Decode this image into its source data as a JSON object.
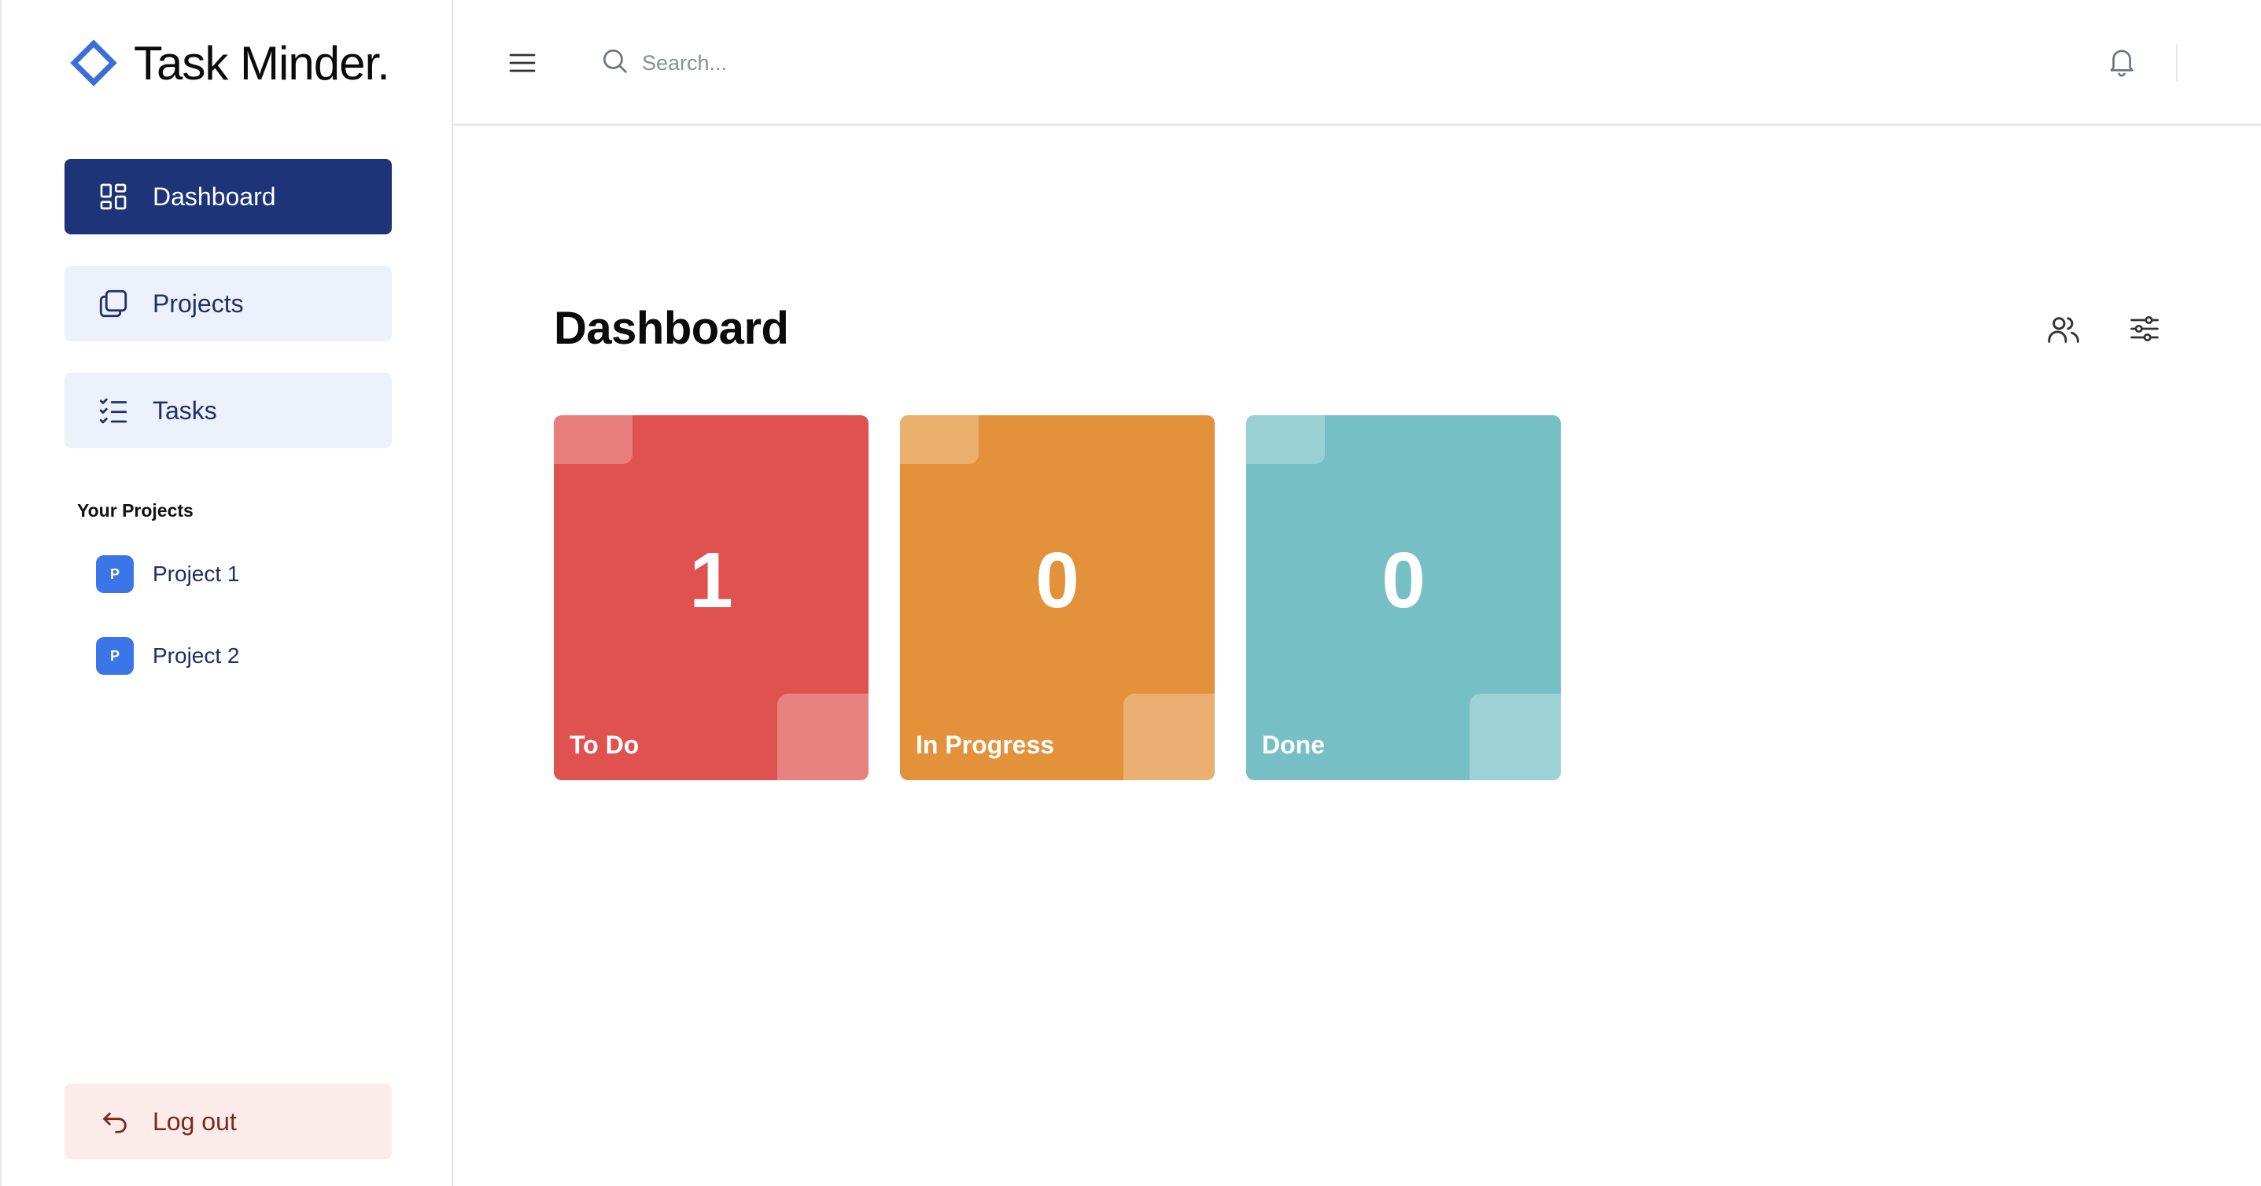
{
  "app": {
    "logo_text": "Task Minder."
  },
  "sidebar": {
    "nav": [
      {
        "label": "Dashboard",
        "icon": "dashboard-icon",
        "active": true
      },
      {
        "label": "Projects",
        "icon": "folders-icon",
        "active": false
      },
      {
        "label": "Tasks",
        "icon": "checklist-icon",
        "active": false
      }
    ],
    "section_title": "Your Projects",
    "projects": [
      {
        "badge": "P",
        "name": "Project 1"
      },
      {
        "badge": "P",
        "name": "Project 2"
      }
    ],
    "logout_label": "Log out"
  },
  "header": {
    "search_placeholder": "Search...",
    "icons": [
      "menu-icon",
      "search-icon",
      "bell-icon"
    ]
  },
  "main": {
    "title": "Dashboard",
    "tools": [
      "team-icon",
      "filter-icon"
    ],
    "cards": [
      {
        "count": "1",
        "label": "To Do",
        "color": "#df524f"
      },
      {
        "count": "0",
        "label": "In Progress",
        "color": "#e3923b"
      },
      {
        "count": "0",
        "label": "Done",
        "color": "#76c0c5"
      }
    ]
  },
  "colors": {
    "primary": "#1e3478",
    "nav_bg": "#edf1fb",
    "logout_bg": "#fbecea",
    "logo_accent": "#3b6fd8"
  }
}
